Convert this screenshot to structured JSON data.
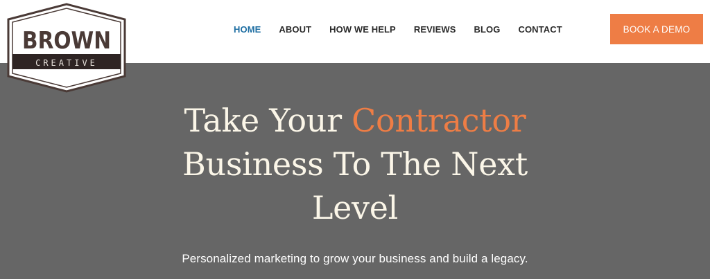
{
  "logo": {
    "line1": "BROWN",
    "line2": "CREATIVE",
    "colors": {
      "outline": "#4a3a36",
      "band": "#2e2423",
      "text": "#4a3a36"
    }
  },
  "nav": {
    "items": [
      {
        "label": "HOME",
        "active": true
      },
      {
        "label": "ABOUT",
        "active": false
      },
      {
        "label": "HOW WE HELP",
        "active": false
      },
      {
        "label": "REVIEWS",
        "active": false
      },
      {
        "label": "BLOG",
        "active": false
      },
      {
        "label": "CONTACT",
        "active": false
      }
    ]
  },
  "cta": {
    "label": "BOOK A DEMO"
  },
  "hero": {
    "title_part1": "Take Your ",
    "title_accent": "Contractor",
    "title_part2": "Business To The Next",
    "title_part3": "Level",
    "subtitle": "Personalized marketing to grow your business and build a legacy."
  },
  "colors": {
    "accent": "#ee7d45",
    "nav_active": "#1f6fa3",
    "hero_bg": "#666666",
    "hero_text": "#fbf6e8"
  }
}
